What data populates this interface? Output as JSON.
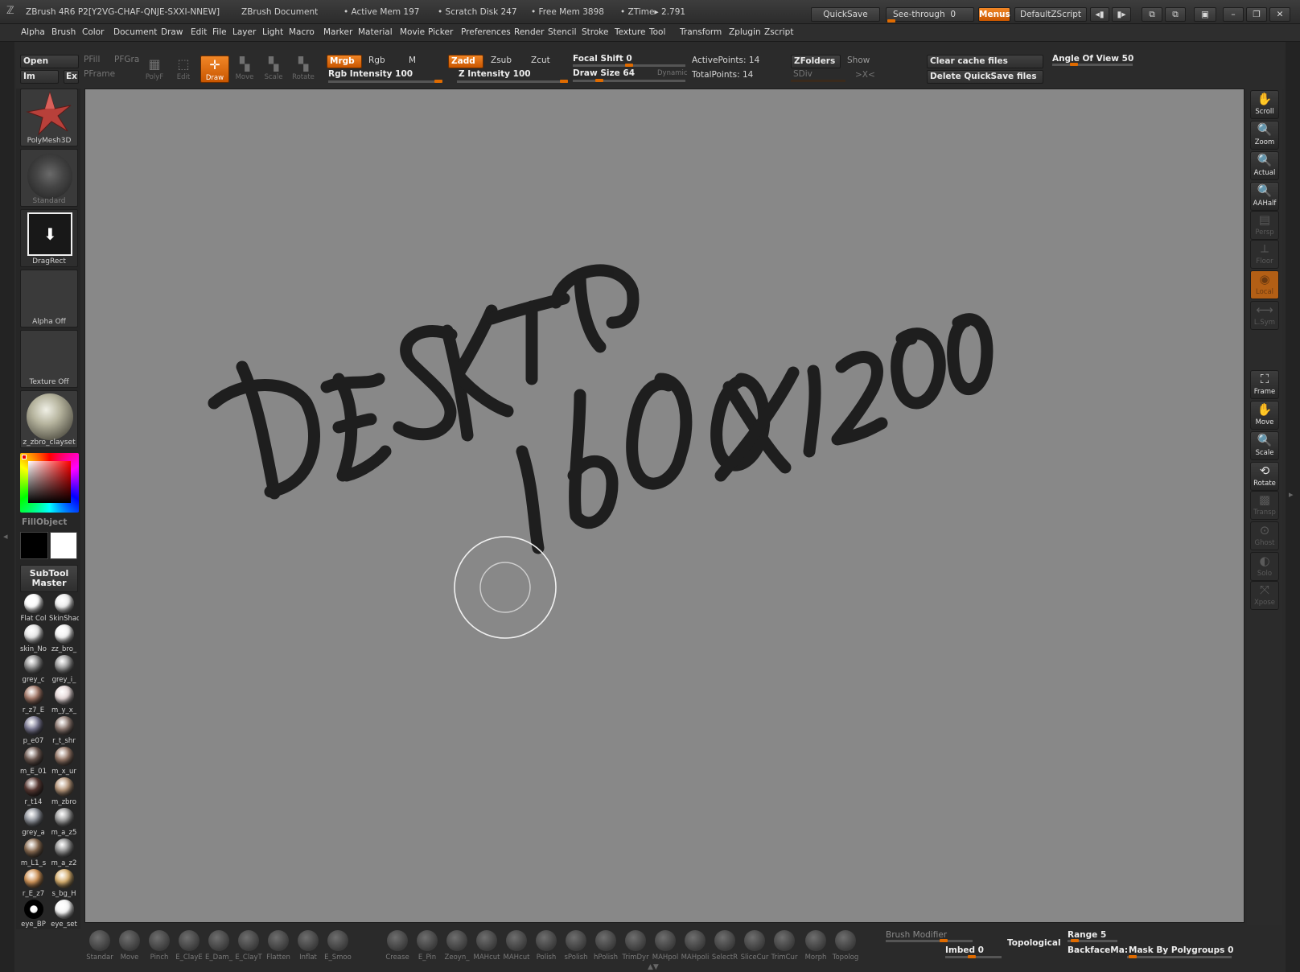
{
  "titlebar": {
    "app": "ZBrush 4R6 P2[Y2VG-CHAF-QNJE-SXXI-NNEW]",
    "doc": "ZBrush Document",
    "active_mem": "• Active Mem 197",
    "scratch_disk": "• Scratch Disk 247",
    "free_mem": "• Free Mem 3898",
    "ztime": "• ZTime▸ 2.791",
    "quicksave": "QuickSave",
    "seethrough": "See-through",
    "seethrough_val": "0",
    "menus": "Menus",
    "zscript": "DefaultZScript"
  },
  "menubar": [
    "Alpha",
    "Brush",
    "Color",
    "Document",
    "Draw",
    "Edit",
    "File",
    "Layer",
    "Light",
    "Macro",
    "Marker",
    "Material",
    "Movie",
    "Picker",
    "Preferences",
    "Render",
    "Stencil",
    "Stroke",
    "Texture",
    "Tool",
    "Transform",
    "Zplugin",
    "Zscript"
  ],
  "topshelf": {
    "open": "Open",
    "im": "Im",
    "ex": "Ex",
    "pfill": "PFill",
    "pfgra": "PFGra",
    "pframe": "PFrame",
    "polyf": "PolyF",
    "edit": "Edit",
    "draw": "Draw",
    "move": "Move",
    "scale": "Scale",
    "rotate": "Rotate",
    "mrgb": "Mrgb",
    "rgb": "Rgb",
    "m": "M",
    "rgb_intensity": "Rgb Intensity 100",
    "zadd": "Zadd",
    "zsub": "Zsub",
    "zcut": "Zcut",
    "z_intensity": "Z Intensity 100",
    "focal_shift": "Focal Shift 0",
    "draw_size": "Draw Size 64",
    "dynamic": "Dynamic",
    "active_points": "ActivePoints: 14",
    "total_points": "TotalPoints: 14",
    "zfolders": "ZFolders",
    "show": "Show",
    "sdiv": "SDiv",
    "xc": ">X<",
    "clear_cache": "Clear cache files",
    "delete_quicksave": "Delete QuickSave files",
    "angle_of_view": "Angle Of View 50"
  },
  "leftpanel": {
    "tool": "PolyMesh3D",
    "brush": "Standard",
    "stroke": "DragRect",
    "alpha": "Alpha Off",
    "texture": "Texture Off",
    "material": "z_zbro_clayset",
    "fillobject": "FillObject",
    "subtool_master": "SubTool\nMaster",
    "matcaps": [
      {
        "name": "Flat Col",
        "color": "#ffffff"
      },
      {
        "name": "SkinShad",
        "color": "#f0f0f0"
      },
      {
        "name": "skin_No",
        "color": "#e8e8e8"
      },
      {
        "name": "zz_bro_",
        "color": "#f4f4f4"
      },
      {
        "name": "grey_c",
        "color": "#8d8d8d"
      },
      {
        "name": "grey_i_",
        "color": "#9a9a9a"
      },
      {
        "name": "r_z7_E",
        "color": "#a57a6a"
      },
      {
        "name": "m_y_x_",
        "color": "#e8dada"
      },
      {
        "name": "p_e07",
        "color": "#7c7a94"
      },
      {
        "name": "r_t_shr",
        "color": "#8e7a72"
      },
      {
        "name": "m_E_01",
        "color": "#6e5a52"
      },
      {
        "name": "m_x_ur",
        "color": "#967868"
      },
      {
        "name": "r_t14",
        "color": "#5a3a34"
      },
      {
        "name": "m_zbro",
        "color": "#b6967a"
      },
      {
        "name": "grey_a",
        "color": "#8e929a"
      },
      {
        "name": "m_a_z5",
        "color": "#9a9a9a"
      },
      {
        "name": "m_L1_s",
        "color": "#8a6c52"
      },
      {
        "name": "m_a_z2",
        "color": "#8e8e8e"
      },
      {
        "name": "r_E_z7",
        "color": "#d2965a"
      },
      {
        "name": "s_bg_H",
        "color": "#d8b070"
      },
      {
        "name": "eye_BP",
        "color": "#111111"
      },
      {
        "name": "eye_set",
        "color": "#f8f8f8"
      }
    ]
  },
  "rightshelf": [
    "Scroll",
    "Zoom",
    "Actual",
    "AAHalf",
    "Persp",
    "Floor",
    "Local",
    "L.Sym",
    "Frame",
    "Move",
    "Scale",
    "Rotate",
    "Transp",
    "Ghost",
    "Solo",
    "Xpose"
  ],
  "bottombar": {
    "brushes": [
      "Standar",
      "Move",
      "Pinch",
      "E_ClayE",
      "E_Dam_",
      "E_ClayT",
      "Flatten",
      "Inflat",
      "E_Smoo",
      "Crease",
      "E_Pin",
      "Zeoyn_",
      "MAHcut",
      "MAHcut",
      "Polish",
      "sPolish",
      "hPolish",
      "TrimDyr",
      "MAHpol",
      "MAHpoli",
      "SelectR",
      "SliceCur",
      "TrimCur",
      "Morph",
      "Topolog"
    ],
    "brush_modifier": "Brush Modifier",
    "imbed": "Imbed 0",
    "topological": "Topological",
    "range": "Range 5",
    "backfacemask": "BackfaceMa:",
    "mask_by_polygroups": "Mask By Polygroups 0"
  },
  "canvas": {
    "handwriting_line1": "DESKTOP",
    "handwriting_line2": "1600x1200"
  },
  "colors": {
    "accent": "#f07c1a",
    "canvas": "#888888",
    "panel": "#2b2b2b"
  }
}
